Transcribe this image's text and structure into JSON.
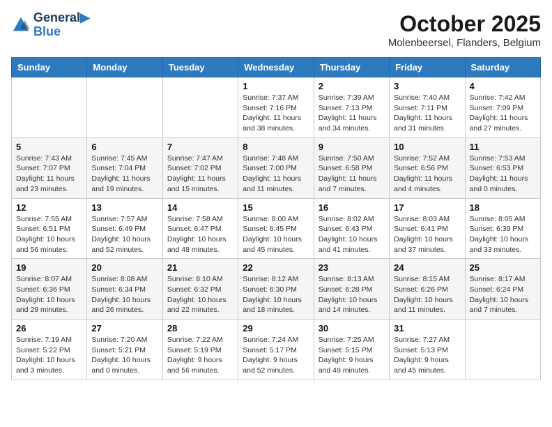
{
  "header": {
    "logo_line1": "General",
    "logo_line2": "Blue",
    "month": "October 2025",
    "location": "Molenbeersel, Flanders, Belgium"
  },
  "weekdays": [
    "Sunday",
    "Monday",
    "Tuesday",
    "Wednesday",
    "Thursday",
    "Friday",
    "Saturday"
  ],
  "weeks": [
    [
      {
        "day": "",
        "info": ""
      },
      {
        "day": "",
        "info": ""
      },
      {
        "day": "",
        "info": ""
      },
      {
        "day": "1",
        "info": "Sunrise: 7:37 AM\nSunset: 7:16 PM\nDaylight: 11 hours\nand 38 minutes."
      },
      {
        "day": "2",
        "info": "Sunrise: 7:39 AM\nSunset: 7:13 PM\nDaylight: 11 hours\nand 34 minutes."
      },
      {
        "day": "3",
        "info": "Sunrise: 7:40 AM\nSunset: 7:11 PM\nDaylight: 11 hours\nand 31 minutes."
      },
      {
        "day": "4",
        "info": "Sunrise: 7:42 AM\nSunset: 7:09 PM\nDaylight: 11 hours\nand 27 minutes."
      }
    ],
    [
      {
        "day": "5",
        "info": "Sunrise: 7:43 AM\nSunset: 7:07 PM\nDaylight: 11 hours\nand 23 minutes."
      },
      {
        "day": "6",
        "info": "Sunrise: 7:45 AM\nSunset: 7:04 PM\nDaylight: 11 hours\nand 19 minutes."
      },
      {
        "day": "7",
        "info": "Sunrise: 7:47 AM\nSunset: 7:02 PM\nDaylight: 11 hours\nand 15 minutes."
      },
      {
        "day": "8",
        "info": "Sunrise: 7:48 AM\nSunset: 7:00 PM\nDaylight: 11 hours\nand 11 minutes."
      },
      {
        "day": "9",
        "info": "Sunrise: 7:50 AM\nSunset: 6:58 PM\nDaylight: 11 hours\nand 7 minutes."
      },
      {
        "day": "10",
        "info": "Sunrise: 7:52 AM\nSunset: 6:56 PM\nDaylight: 11 hours\nand 4 minutes."
      },
      {
        "day": "11",
        "info": "Sunrise: 7:53 AM\nSunset: 6:53 PM\nDaylight: 11 hours\nand 0 minutes."
      }
    ],
    [
      {
        "day": "12",
        "info": "Sunrise: 7:55 AM\nSunset: 6:51 PM\nDaylight: 10 hours\nand 56 minutes."
      },
      {
        "day": "13",
        "info": "Sunrise: 7:57 AM\nSunset: 6:49 PM\nDaylight: 10 hours\nand 52 minutes."
      },
      {
        "day": "14",
        "info": "Sunrise: 7:58 AM\nSunset: 6:47 PM\nDaylight: 10 hours\nand 48 minutes."
      },
      {
        "day": "15",
        "info": "Sunrise: 8:00 AM\nSunset: 6:45 PM\nDaylight: 10 hours\nand 45 minutes."
      },
      {
        "day": "16",
        "info": "Sunrise: 8:02 AM\nSunset: 6:43 PM\nDaylight: 10 hours\nand 41 minutes."
      },
      {
        "day": "17",
        "info": "Sunrise: 8:03 AM\nSunset: 6:41 PM\nDaylight: 10 hours\nand 37 minutes."
      },
      {
        "day": "18",
        "info": "Sunrise: 8:05 AM\nSunset: 6:39 PM\nDaylight: 10 hours\nand 33 minutes."
      }
    ],
    [
      {
        "day": "19",
        "info": "Sunrise: 8:07 AM\nSunset: 6:36 PM\nDaylight: 10 hours\nand 29 minutes."
      },
      {
        "day": "20",
        "info": "Sunrise: 8:08 AM\nSunset: 6:34 PM\nDaylight: 10 hours\nand 26 minutes."
      },
      {
        "day": "21",
        "info": "Sunrise: 8:10 AM\nSunset: 6:32 PM\nDaylight: 10 hours\nand 22 minutes."
      },
      {
        "day": "22",
        "info": "Sunrise: 8:12 AM\nSunset: 6:30 PM\nDaylight: 10 hours\nand 18 minutes."
      },
      {
        "day": "23",
        "info": "Sunrise: 8:13 AM\nSunset: 6:28 PM\nDaylight: 10 hours\nand 14 minutes."
      },
      {
        "day": "24",
        "info": "Sunrise: 8:15 AM\nSunset: 6:26 PM\nDaylight: 10 hours\nand 11 minutes."
      },
      {
        "day": "25",
        "info": "Sunrise: 8:17 AM\nSunset: 6:24 PM\nDaylight: 10 hours\nand 7 minutes."
      }
    ],
    [
      {
        "day": "26",
        "info": "Sunrise: 7:19 AM\nSunset: 5:22 PM\nDaylight: 10 hours\nand 3 minutes."
      },
      {
        "day": "27",
        "info": "Sunrise: 7:20 AM\nSunset: 5:21 PM\nDaylight: 10 hours\nand 0 minutes."
      },
      {
        "day": "28",
        "info": "Sunrise: 7:22 AM\nSunset: 5:19 PM\nDaylight: 9 hours\nand 56 minutes."
      },
      {
        "day": "29",
        "info": "Sunrise: 7:24 AM\nSunset: 5:17 PM\nDaylight: 9 hours\nand 52 minutes."
      },
      {
        "day": "30",
        "info": "Sunrise: 7:25 AM\nSunset: 5:15 PM\nDaylight: 9 hours\nand 49 minutes."
      },
      {
        "day": "31",
        "info": "Sunrise: 7:27 AM\nSunset: 5:13 PM\nDaylight: 9 hours\nand 45 minutes."
      },
      {
        "day": "",
        "info": ""
      }
    ]
  ]
}
